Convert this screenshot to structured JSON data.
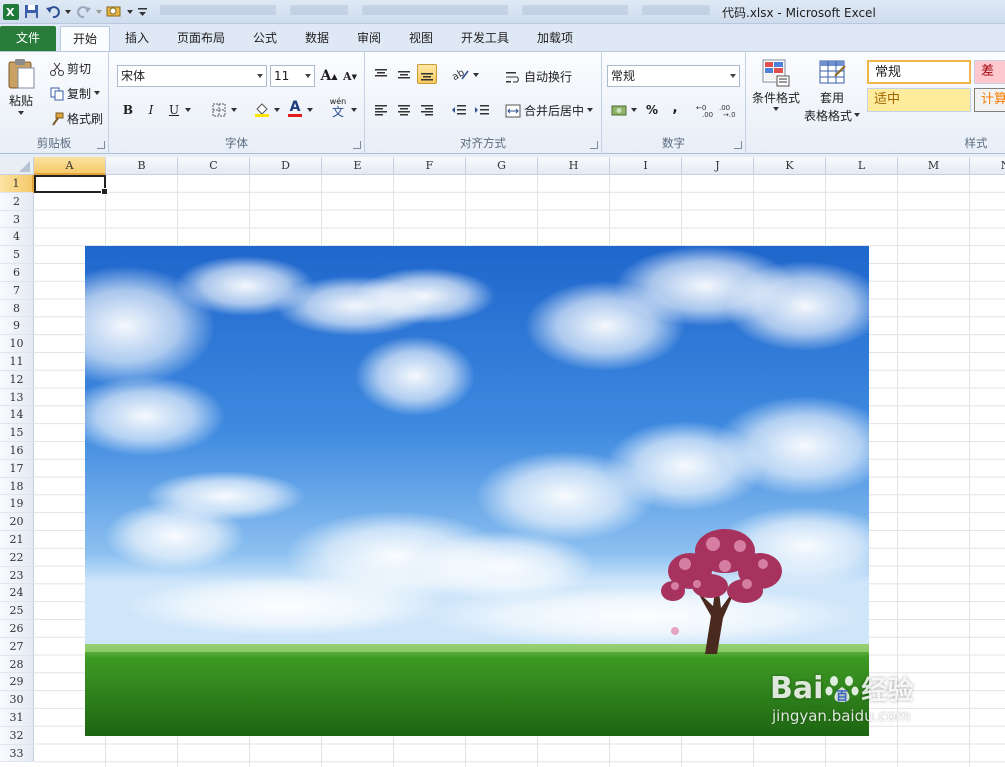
{
  "window": {
    "title": "代码.xlsx - Microsoft Excel"
  },
  "tabs": [
    "文件",
    "开始",
    "插入",
    "页面布局",
    "公式",
    "数据",
    "审阅",
    "视图",
    "开发工具",
    "加载项"
  ],
  "clipboard": {
    "paste": "粘贴",
    "cut": "剪切",
    "copy": "复制",
    "format_painter": "格式刷",
    "label": "剪贴板"
  },
  "font": {
    "name": "宋体",
    "size": "11",
    "bold": "B",
    "italic": "I",
    "underline": "U",
    "grow": "A",
    "shrink": "A",
    "color_letter": "A",
    "phonetic_top": "wén",
    "phonetic_bottom": "文",
    "label": "字体"
  },
  "alignment": {
    "wrap": "自动换行",
    "merge": "合并后居中",
    "label": "对齐方式"
  },
  "number": {
    "format": "常规",
    "percent": "%",
    "comma": ",",
    "label": "数字"
  },
  "styles": {
    "conditional": "条件格式",
    "table_fmt_top": "套用",
    "table_fmt_bottom": "表格格式",
    "normal": "常规",
    "bad": "差",
    "neutral": "适中",
    "calc": "计算",
    "label": "样式"
  },
  "columns": [
    "A",
    "B",
    "C",
    "D",
    "E",
    "F",
    "G",
    "H",
    "I",
    "J",
    "K",
    "L",
    "M",
    "N"
  ],
  "rows": [
    "1",
    "2",
    "3",
    "4",
    "5",
    "6",
    "7",
    "8",
    "9",
    "10",
    "11",
    "12",
    "13",
    "14",
    "15",
    "16",
    "17",
    "18",
    "19",
    "20",
    "21",
    "22",
    "23",
    "24",
    "25",
    "26",
    "27",
    "28",
    "29",
    "30",
    "31",
    "32",
    "33"
  ],
  "selected_cell": {
    "column": "A",
    "row": "1"
  },
  "watermark": {
    "brand": "Bai",
    "brand2": "百",
    "suffix": "经验",
    "url": "jingyan.baidu.com"
  },
  "colors": {
    "file_tab": "#2a7c3b",
    "selection": "#f6c96a",
    "sky": "#2f78d6",
    "grass": "#2f8a1e"
  }
}
